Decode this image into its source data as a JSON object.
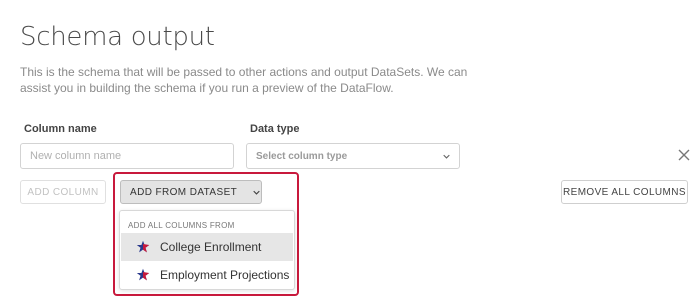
{
  "page": {
    "title": "Schema output",
    "description": "This is the schema that will be passed to other actions and output DataSets. We can assist you in building the schema if you run a preview of the DataFlow."
  },
  "form": {
    "column_name_label": "Column name",
    "data_type_label": "Data type",
    "column_name_placeholder": "New column name",
    "column_name_value": "",
    "data_type_placeholder": "Select column type",
    "remove_icon": "close-icon"
  },
  "buttons": {
    "add_column": "ADD COLUMN",
    "add_from_dataset": "ADD FROM DATASET",
    "remove_all_columns": "REMOVE ALL COLUMNS"
  },
  "dropdown": {
    "header": "ADD ALL COLUMNS FROM",
    "items": [
      {
        "label": "College Enrollment",
        "icon": "dataset-star-icon",
        "hovered": true
      },
      {
        "label": "Employment Projections",
        "icon": "dataset-star-icon",
        "hovered": false
      }
    ]
  },
  "colors": {
    "highlight_border": "#c8193c",
    "star_blue": "#2b3a8c",
    "star_red": "#c8193c"
  }
}
